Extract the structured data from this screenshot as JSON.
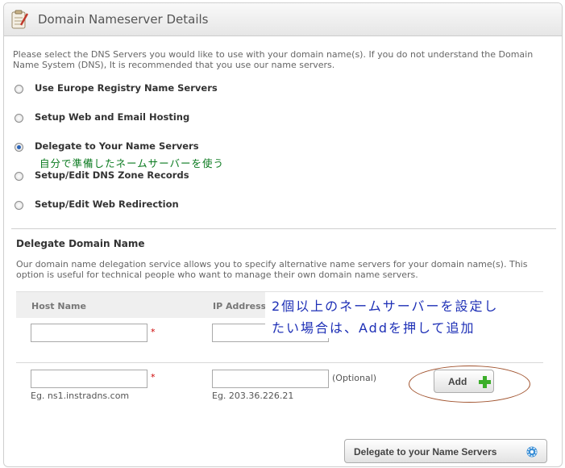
{
  "header": {
    "title": "Domain Nameserver Details"
  },
  "intro": "Please select the DNS Servers you would like to use with your domain name(s). If you do not understand the Domain Name System (DNS), It is recommended that you use our name servers.",
  "options": [
    {
      "label": "Use Europe Registry Name Servers",
      "checked": false
    },
    {
      "label": "Setup Web and Email Hosting",
      "checked": false
    },
    {
      "label": "Delegate to Your Name Servers",
      "checked": true
    },
    {
      "label": "Setup/Edit DNS Zone Records",
      "checked": false
    },
    {
      "label": "Setup/Edit Web Redirection",
      "checked": false
    }
  ],
  "annotation_option": "自分で準備したネームサーバーを使う",
  "delegate": {
    "title": "Delegate Domain Name",
    "description": "Our domain name delegation service allows you to specify alternative name servers for your domain name(s). This option is useful for technical people who want to manage their own domain name servers.",
    "columns": {
      "host": "Host Name",
      "ip": "IP Address"
    },
    "rows": [
      {
        "host_value": "",
        "ip_value": ""
      },
      {
        "host_value": "",
        "ip_value": ""
      }
    ],
    "required_mark": "*",
    "optional_label": "(Optional)",
    "host_hint": "Eg. ns1.instradns.com",
    "ip_hint": "Eg. 203.36.226.21",
    "add_label": "Add",
    "submit_label": "Delegate to your Name Servers"
  },
  "annotation_add": {
    "line1": "2個以上のネームサーバーを設定し",
    "line2": "たい場合は、Addを押して追加"
  },
  "colors": {
    "accent_blue": "#2a63b7",
    "plus_green": "#3cae2a",
    "annotation_blue": "#1d2fb6",
    "annotation_green": "#0a7a1f"
  }
}
